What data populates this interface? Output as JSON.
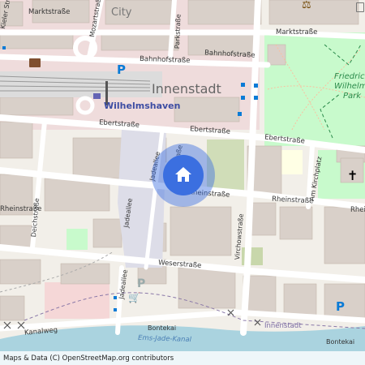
{
  "map": {
    "districts": {
      "city": "City",
      "innenstadt": "Innenstadt"
    },
    "place": "Wilhelmshaven",
    "park": {
      "line1": "Friedrich-",
      "line2": "Wilhelm-",
      "line3": "Park"
    },
    "streets": {
      "marktstrasse_w": "Marktstraße",
      "marktstrasse_e": "Marktstraße",
      "kieler": "Kieler Straße",
      "mozart": "Mozartstraße",
      "park": "Parkstraße",
      "bahnhof1": "Bahnhofstraße",
      "bahnhof2": "Bahnhofstraße",
      "ebert_w": "Ebertstraße",
      "ebert_m": "Ebertstraße",
      "ebert_e": "Ebertstraße",
      "jadeallee_n": "Jadeallee",
      "jadeallee_m": "Jadeallee",
      "jadeallee_s": "Jadeallee",
      "jadestrasse": "Jadestraße",
      "rhein_w": "Rheinstraße",
      "rhein_m": "Rheinstraße",
      "rhein_e": "Rheinstraße",
      "rhein_far": "Rheinstraße",
      "deich": "Deichstraße",
      "virchow": "Virchowstraße",
      "weser": "Weserstraße",
      "kirchplatz": "Am Kirchplatz",
      "kanalweg": "Kanalweg",
      "bontekai1": "Bontekai",
      "bontekai2": "Bontekai",
      "innenstadt_boundary": "Innenstadt"
    },
    "waterway": "Ems-Jade-Kanal",
    "marker": {
      "icon": "home-icon",
      "color": "#3b6fe0"
    },
    "colors": {
      "water": "#aad3df",
      "park": "#c8facc",
      "building": "#d9d0c9",
      "road": "#ffffff",
      "pedestrian": "#dddde8"
    }
  },
  "attribution": "Maps & Data (C) OpenStreetMap.org contributors"
}
